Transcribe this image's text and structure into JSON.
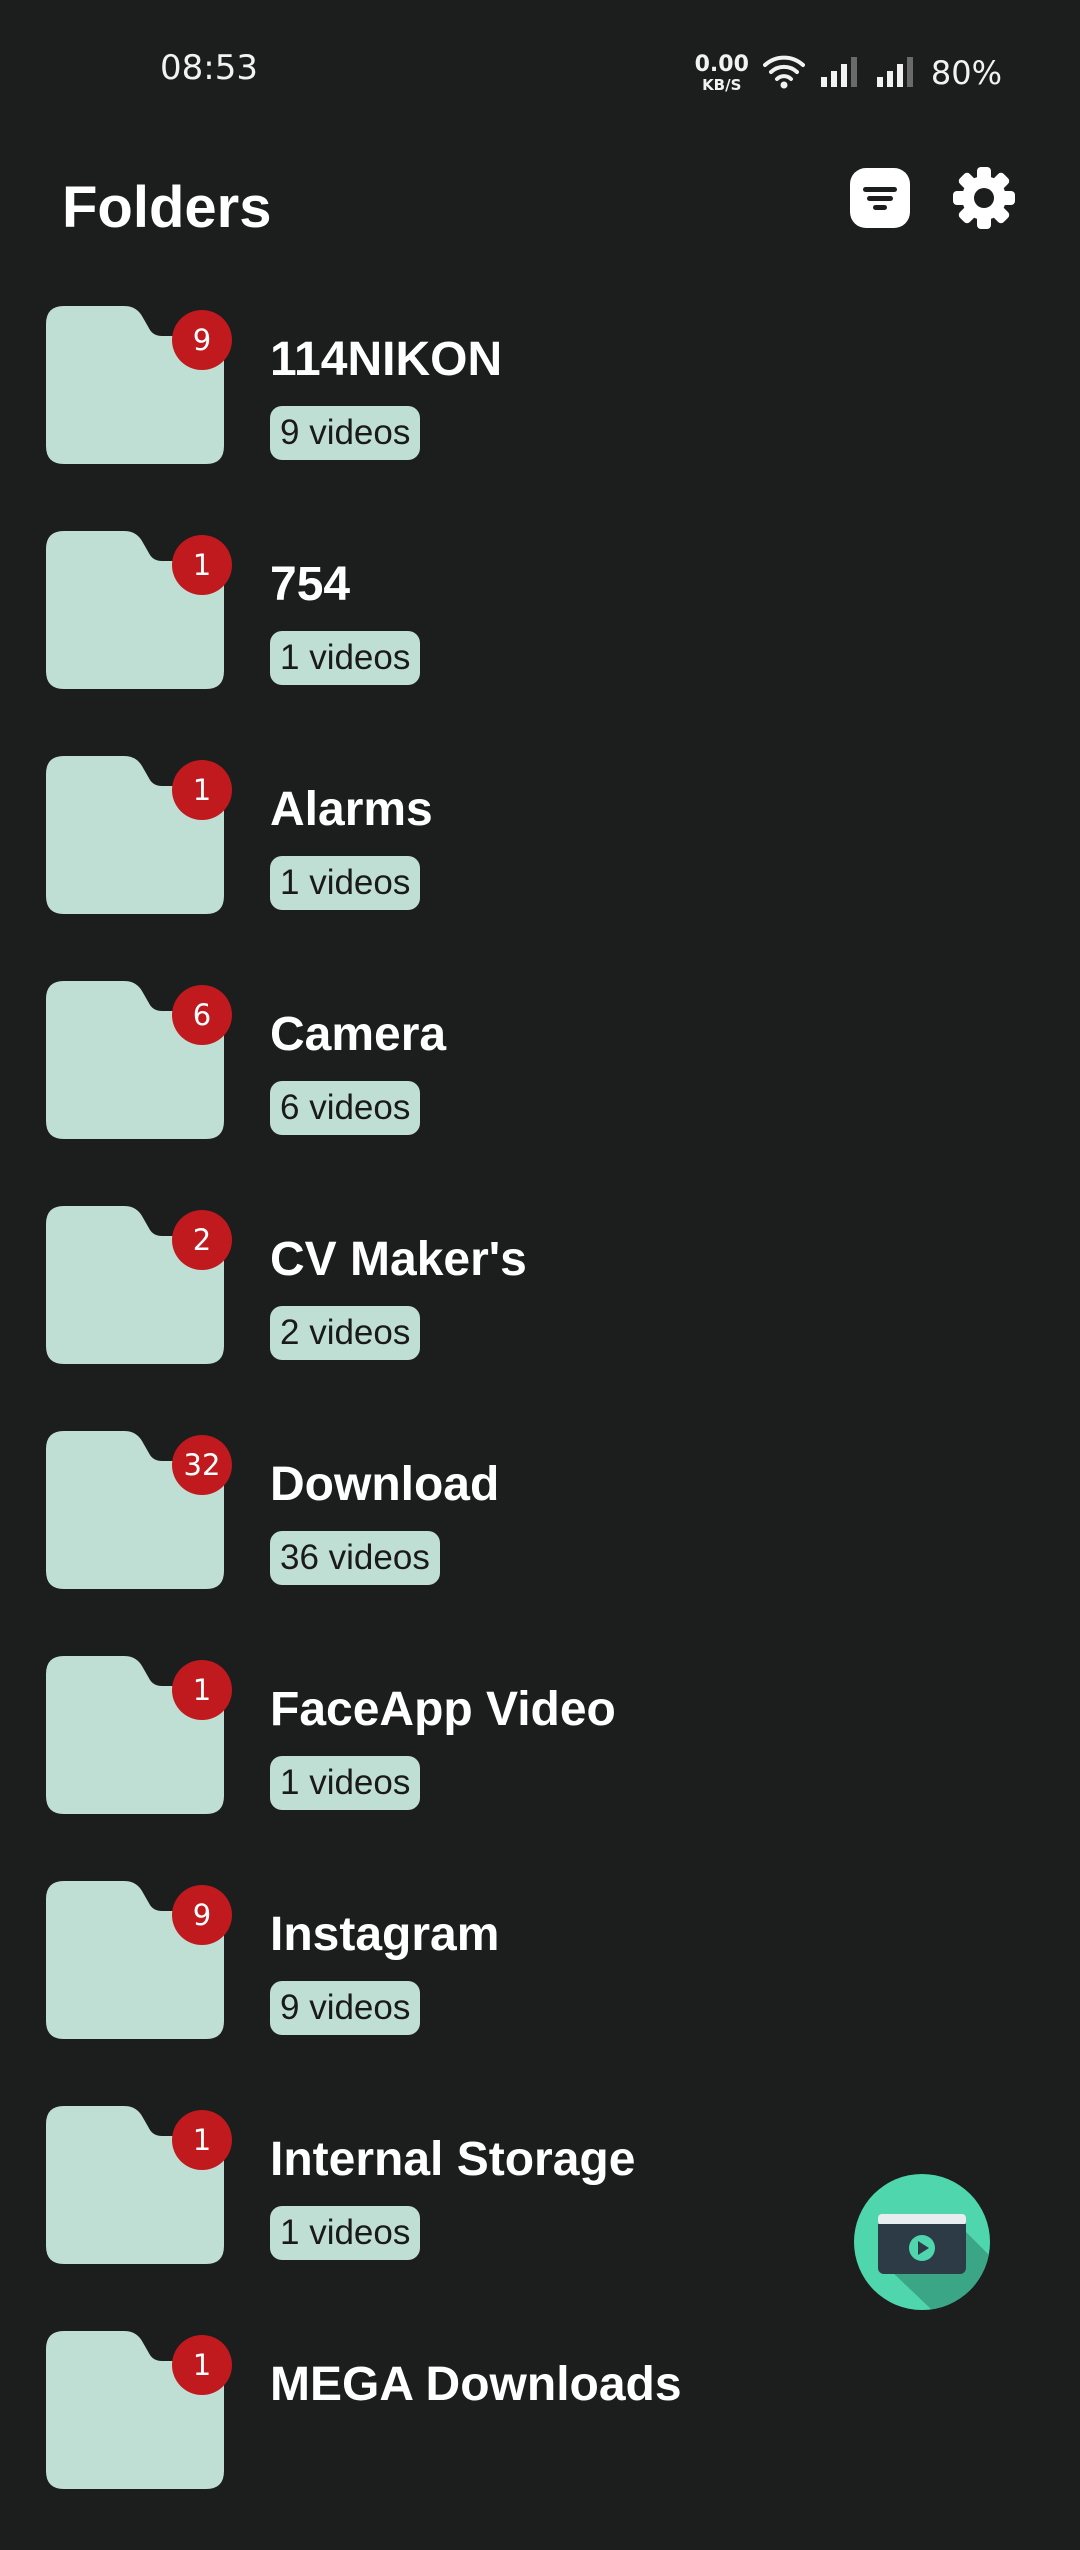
{
  "status_bar": {
    "time": "08:53",
    "net_speed_value": "0.00",
    "net_speed_unit": "KB/S",
    "battery": "80%"
  },
  "header": {
    "title": "Folders"
  },
  "colors": {
    "background": "#1c1d1d",
    "folder": "#bfded4",
    "badge": "#c0191e",
    "fab": "#4fd6ad"
  },
  "folders": [
    {
      "name": "114NIKON",
      "badge": "9",
      "count": "9 videos"
    },
    {
      "name": "754",
      "badge": "1",
      "count": "1 videos"
    },
    {
      "name": "Alarms",
      "badge": "1",
      "count": "1 videos"
    },
    {
      "name": "Camera",
      "badge": "6",
      "count": "6 videos"
    },
    {
      "name": "CV Maker's",
      "badge": "2",
      "count": "2 videos"
    },
    {
      "name": "Download",
      "badge": "32",
      "count": "36 videos"
    },
    {
      "name": "FaceApp Video",
      "badge": "1",
      "count": "1 videos"
    },
    {
      "name": "Instagram",
      "badge": "9",
      "count": "9 videos"
    },
    {
      "name": "Internal Storage",
      "badge": "1",
      "count": "1 videos"
    },
    {
      "name": "MEGA Downloads",
      "badge": "1",
      "count": ""
    }
  ],
  "icons": {
    "filter": "sort-filter-icon",
    "settings": "gear-icon",
    "fab": "video-player-icon"
  }
}
